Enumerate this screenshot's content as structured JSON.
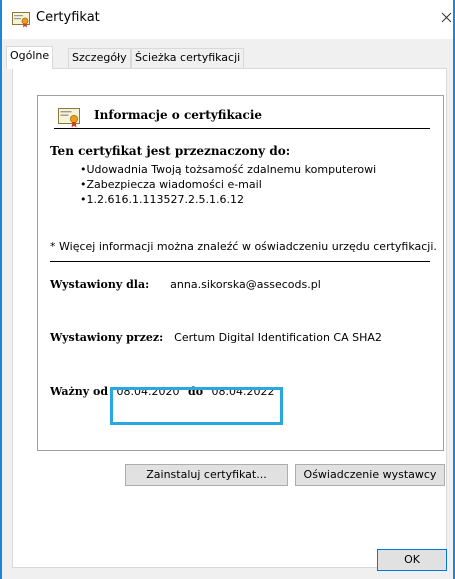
{
  "window": {
    "title": "Certyfikat",
    "close_glyph": "✕"
  },
  "tabs": [
    {
      "label": "Ogólne",
      "active": true
    },
    {
      "label": "Szczegóły",
      "active": false
    },
    {
      "label": "Ścieżka certyfikacji",
      "active": false
    }
  ],
  "info": {
    "title": "Informacje o certyfikacie",
    "purpose_title": "Ten certyfikat jest przeznaczony do:",
    "purposes": [
      "Udowadnia Twoją tożsamość zdalnemu komputerowi",
      "Zabezpiecza wiadomości e-mail",
      "1.2.616.1.113527.2.5.1.6.12"
    ],
    "more_info": "* Więcej informacji można znaleźć w oświadczeniu urzędu certyfikacji.",
    "issued_to_label": "Wystawiony dla:",
    "issued_to_value": "anna.sikorska@assecods.pl",
    "issued_by_label": "Wystawiony przez:",
    "issued_by_value": "Certum Digital Identification CA SHA2",
    "valid_from_label": "Ważny od",
    "valid_from_value": "08.04.2020",
    "valid_to_label": "do",
    "valid_to_value": "08.04.2022"
  },
  "buttons": {
    "install": "Zainstaluj certyfikat...",
    "issuer_statement": "Oświadczenie wystawcy",
    "ok": "OK"
  },
  "icons": {
    "title_icon": "certificate-icon",
    "info_icon": "certificate-icon"
  },
  "colors": {
    "window_border": "#1e86d6",
    "highlight": "#29a8e0",
    "button_focus": "#0078d7"
  }
}
